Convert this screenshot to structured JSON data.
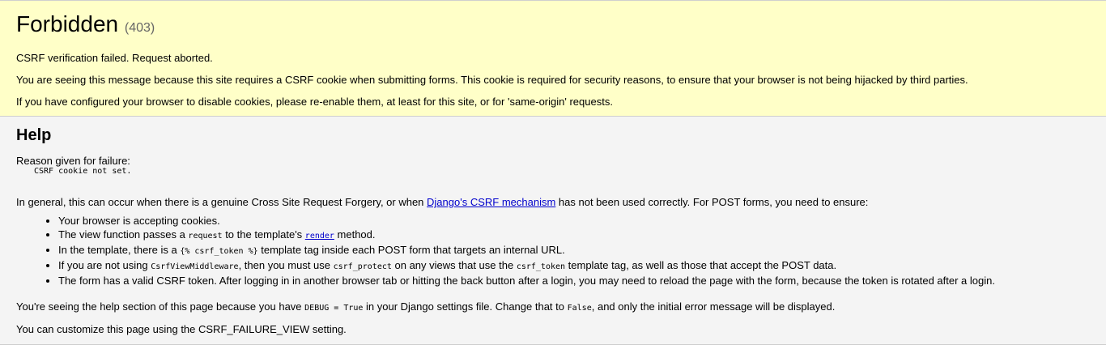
{
  "summary": {
    "title": "Forbidden",
    "code": "(403)",
    "message": "CSRF verification failed. Request aborted.",
    "explain": "You are seeing this message because this site requires a CSRF cookie when submitting forms. This cookie is required for security reasons, to ensure that your browser is not being hijacked by third parties.",
    "cookies": "If you have configured your browser to disable cookies, please re-enable them, at least for this site, or for 'same-origin' requests."
  },
  "help": {
    "title": "Help",
    "reason_label": "Reason given for failure:",
    "reason": "CSRF cookie not set.",
    "general_before": "In general, this can occur when there is a genuine Cross Site Request Forgery, or when ",
    "general_link": "Django's CSRF mechanism",
    "general_after": " has not been used correctly. For POST forms, you need to ensure:",
    "items": {
      "i1": "Your browser is accepting cookies.",
      "i2_a": "The view function passes a ",
      "i2_code": "request",
      "i2_b": " to the template's ",
      "i2_link": "render",
      "i2_c": " method.",
      "i3_a": "In the template, there is a ",
      "i3_code": "{% csrf_token %}",
      "i3_b": " template tag inside each POST form that targets an internal URL.",
      "i4_a": "If you are not using ",
      "i4_code1": "CsrfViewMiddleware",
      "i4_b": ", then you must use ",
      "i4_code2": "csrf_protect",
      "i4_c": " on any views that use the ",
      "i4_code3": "csrf_token",
      "i4_d": " template tag, as well as those that accept the POST data.",
      "i5": "The form has a valid CSRF token. After logging in in another browser tab or hitting the back button after a login, you may need to reload the page with the form, because the token is rotated after a login."
    },
    "debug_a": "You're seeing the help section of this page because you have ",
    "debug_code1": "DEBUG = True",
    "debug_b": " in your Django settings file. Change that to ",
    "debug_code2": "False",
    "debug_c": ", and only the initial error message will be displayed.",
    "custom": "You can customize this page using the CSRF_FAILURE_VIEW setting."
  },
  "colors": {
    "summary_bg": "#ffffc8",
    "help_bg": "#f4f4f4",
    "link": "#0000cc"
  }
}
